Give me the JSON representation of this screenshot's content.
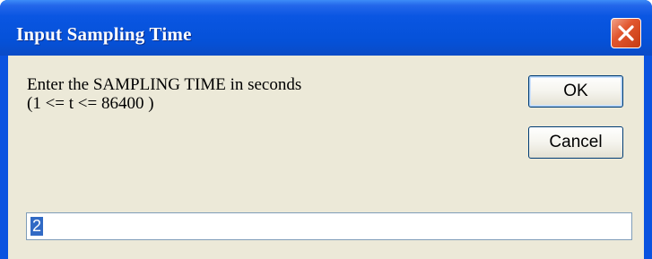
{
  "window": {
    "title": "Input Sampling Time",
    "close_icon": "close-x-icon",
    "accent": "#0a53e0",
    "close_color": "#e2572f"
  },
  "dialog": {
    "prompt_line1": "Enter the SAMPLING TIME in seconds",
    "prompt_line2": "(1 <= t <= 86400 )",
    "ok_label": "OK",
    "cancel_label": "Cancel",
    "input_value": "2"
  }
}
